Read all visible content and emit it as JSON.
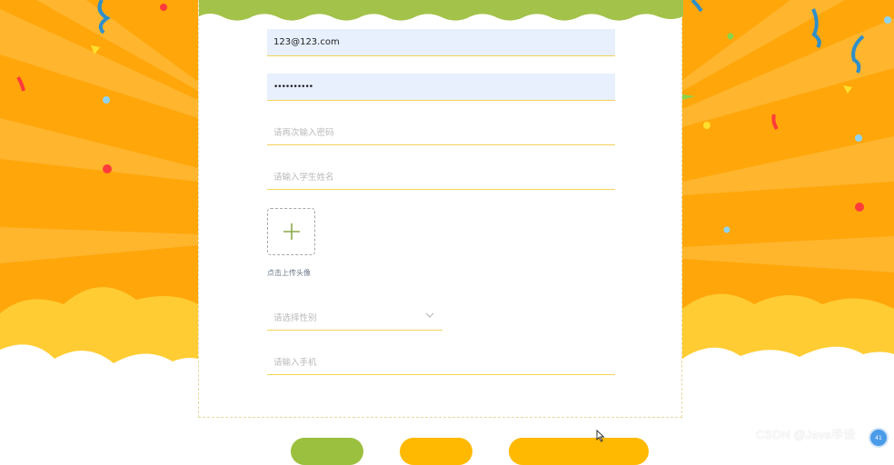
{
  "form": {
    "email_value": "123@123.com",
    "password_value": "••••••••••",
    "confirm_password_placeholder": "请再次输入密码",
    "student_name_placeholder": "请输入学生姓名",
    "avatar_upload_label": "点击上传头像",
    "gender_placeholder": "请选择性别",
    "phone_placeholder": "请输入手机"
  },
  "overlay": {
    "watermark_text": "CSDN @Java毕设",
    "badge_text": "41"
  },
  "colors": {
    "orange": "#ffa60b",
    "orange_light": "#ffc22e",
    "green_banner": "#a3c24a",
    "field_underline": "#f3d35a",
    "autofill_bg": "#e8f0fe",
    "button_green": "#9bbf3e",
    "button_yellow": "#ffb900"
  },
  "icons": {
    "upload": "plus-icon",
    "select": "chevron-down-icon"
  }
}
